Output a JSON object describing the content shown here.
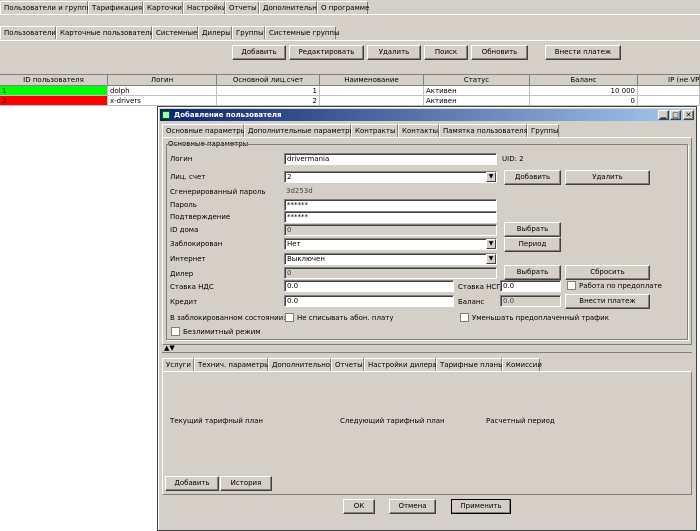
{
  "main_tabs": [
    "Пользователи и группы",
    "Тарификация",
    "Карточки",
    "Настройки",
    "Отчеты",
    "Дополнительно",
    "О программе"
  ],
  "sub_tabs": [
    "Пользователи",
    "Карточные пользователи",
    "Системные",
    "Дилеры",
    "Группы",
    "Системные группы"
  ],
  "toolbar": [
    "Добавить",
    "Редактировать",
    "Удалить",
    "Поиск",
    "Обновить",
    "Внести платеж"
  ],
  "table": {
    "headers": [
      "ID пользователя",
      "Логин",
      "Основной лиц.счет",
      "Наименование",
      "Статус",
      "Баланс",
      "IP (не VPN)"
    ],
    "rows": [
      {
        "id": "1",
        "login": "dolph",
        "account": "1",
        "name": "",
        "status": "Активен",
        "balance": "10 000",
        "color": "#00ff00"
      },
      {
        "id": "2",
        "login": "x-drivers",
        "account": "2",
        "name": "",
        "status": "Активен",
        "balance": "0",
        "color": "#ff0000"
      }
    ]
  },
  "dialog": {
    "title": "Добавление пользователя",
    "tabs": [
      "Основные параметры",
      "Дополнительные параметры",
      "Контракты",
      "Контакты",
      "Памятка пользователя",
      "Группы"
    ],
    "group_title": "Основные параметры",
    "login_label": "Логин",
    "login_value": "drivermania",
    "uid": "UID: 2",
    "account_label": "Лиц. счет",
    "account_value": "2",
    "add_btn": "Добавить",
    "del_btn": "Удалить",
    "gen_pw_label": "Сгенерированный пароль",
    "gen_pw_value": "3d253d",
    "pw_label": "Пароль",
    "pw_value": "******",
    "confirm_label": "Подтверждение",
    "confirm_value": "******",
    "house_label": "ID дома",
    "house_value": "0",
    "choose_btn": "Выбрать",
    "blocked_label": "Заблокирован",
    "blocked_value": "Нет",
    "period_btn": "Период",
    "internet_label": "Интернет",
    "internet_value": "Выключен",
    "dealer_label": "Дилер",
    "dealer_value": "0",
    "choose2_btn": "Выбрать",
    "reset_btn": "Сбросить",
    "vat_label": "Ставка НДС",
    "vat_value": "0.0",
    "nsp_label": "Ставка НСП",
    "nsp_value": "0.0",
    "prepay_label": "Работа по предоплате",
    "credit_label": "Кредит",
    "credit_value": "0.0",
    "balance_label": "Баланс",
    "balance_value": "0.0",
    "pay_btn": "Внести платеж",
    "blocked_state_label": "В заблокированном состоянии:",
    "no_fee_label": "Не списывать абон. плату",
    "reduce_label": "Уменьшать предоплаченный трафик",
    "unlimited_label": "Безлимитный режим",
    "lower_tabs": [
      "Услуги",
      "Технич. параметры",
      "Дополнительно",
      "Отчеты",
      "Настройки дилера",
      "Тарифные планы",
      "Комиссии"
    ],
    "plan_current": "Текущий тарифный план",
    "plan_next": "Следующий тарифный план",
    "plan_period": "Расчетный период",
    "plan_add": "Добавить",
    "plan_history": "История",
    "ok": "ОК",
    "cancel": "Отмена",
    "apply": "Применить"
  }
}
